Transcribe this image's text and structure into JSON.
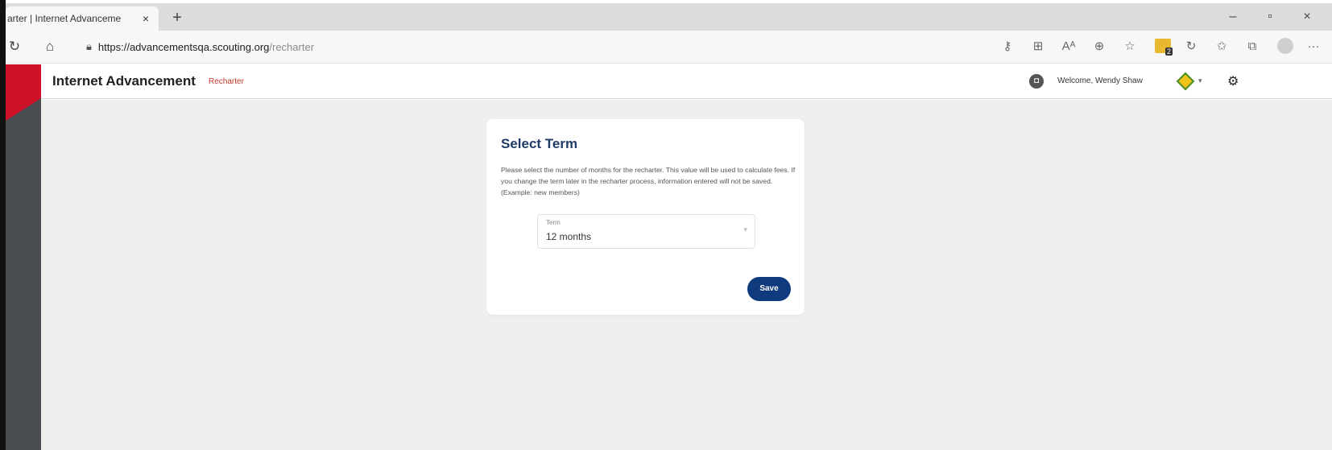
{
  "browser": {
    "tab_title": "arter | Internet Advanceme",
    "tab_close": "×",
    "new_tab": "+",
    "window_controls": [
      "–",
      "▫",
      "×"
    ],
    "nav": {
      "refresh": "↻",
      "home": "⌂"
    },
    "url_host": "https://advancementsqa.scouting.org",
    "url_path": "/recharter",
    "toolbar_icons": [
      "key-icon",
      "grid-icon",
      "read-aloud-icon",
      "zoom-icon",
      "favorite-add-icon",
      "extension-icon",
      "copilot-icon",
      "favorites-icon",
      "collections-icon",
      "profile-icon",
      "more-icon"
    ],
    "extension_badge": "2",
    "more": "···"
  },
  "header": {
    "title": "Internet Advancement",
    "subtitle": "Recharter",
    "welcome": "Welcome, Wendy Shaw"
  },
  "card": {
    "title": "Select Term",
    "description": "Please select the number of months for the recharter. This value will be used to calculate fees. If you change the term later in the recharter process, information entered will not be saved. (Example: new members)",
    "term_label": "Term",
    "term_value": "12 months",
    "save_label": "Save"
  },
  "colors": {
    "brand_red": "#ce1126",
    "title_blue": "#1f3b68",
    "button_blue": "#0f3a7e",
    "rail_gray": "#4a4d52",
    "content_bg": "#efefef"
  }
}
